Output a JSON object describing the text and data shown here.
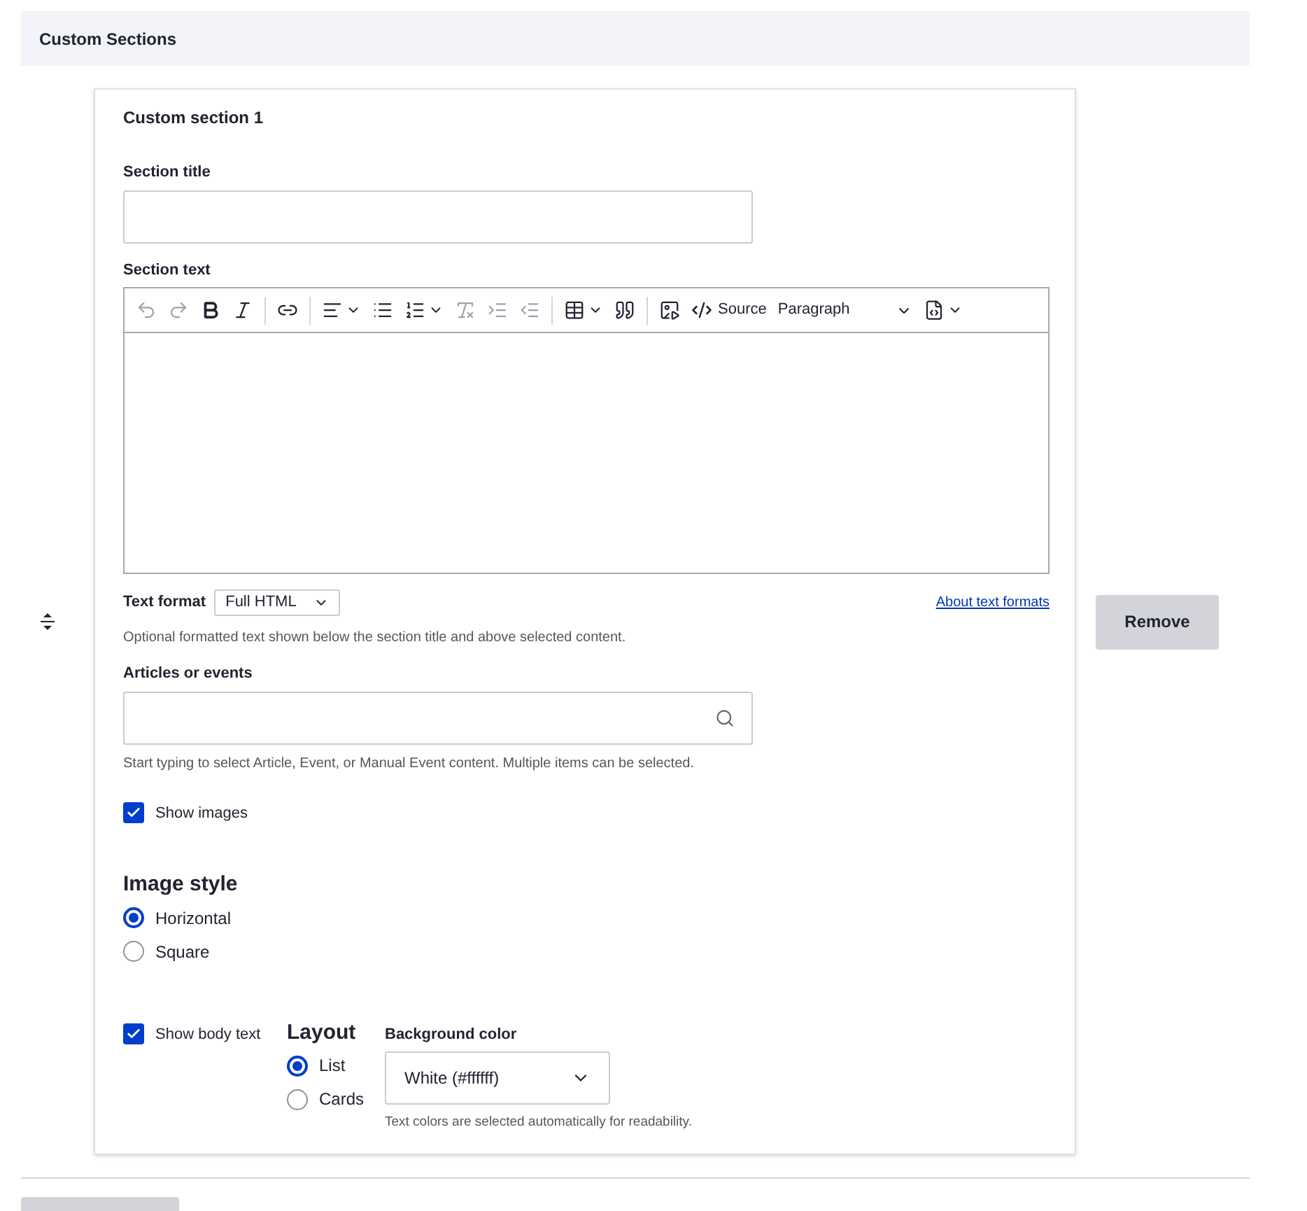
{
  "section_header": {
    "title": "Custom Sections"
  },
  "card": {
    "title": "Custom section 1",
    "section_title": {
      "label": "Section title"
    },
    "section_text": {
      "label": "Section text",
      "toolbar": [
        {
          "kind": "undo",
          "disabled": true
        },
        {
          "kind": "redo",
          "disabled": true
        },
        {
          "kind": "bold",
          "disabled": false
        },
        {
          "kind": "italic",
          "disabled": false
        },
        {
          "kind": "separator"
        },
        {
          "kind": "link",
          "disabled": false
        },
        {
          "kind": "separator"
        },
        {
          "kind": "align",
          "disabled": false
        },
        {
          "kind": "bulleted",
          "disabled": false
        },
        {
          "kind": "numbered",
          "disabled": false
        },
        {
          "kind": "clear",
          "disabled": true
        },
        {
          "kind": "indent",
          "disabled": true
        },
        {
          "kind": "outdent",
          "disabled": true
        },
        {
          "kind": "separator"
        },
        {
          "kind": "table",
          "disabled": false
        },
        {
          "kind": "quote",
          "disabled": false
        },
        {
          "kind": "separator"
        },
        {
          "kind": "media",
          "disabled": false
        },
        {
          "kind": "source",
          "disabled": false,
          "label": "Source"
        },
        {
          "kind": "heading",
          "disabled": false,
          "label": "Paragraph"
        },
        {
          "kind": "more",
          "disabled": false
        }
      ]
    },
    "text_format": {
      "label": "Text format",
      "value": "Full HTML",
      "link": "About text formats",
      "help": "Optional formatted text shown below the section title and above selected content."
    },
    "articles": {
      "label": "Articles or events",
      "help": "Start typing to select Article, Event, or Manual Event content. Multiple items can be selected."
    },
    "show_images": {
      "label": "Show images",
      "checked": true
    },
    "image_style": {
      "title": "Image style",
      "options": [
        {
          "label": "Horizontal",
          "selected": true
        },
        {
          "label": "Square",
          "selected": false
        }
      ]
    },
    "show_body_text": {
      "label": "Show body text",
      "checked": true
    },
    "layout": {
      "title": "Layout",
      "options": [
        {
          "label": "List",
          "selected": true
        },
        {
          "label": "Cards",
          "selected": false
        }
      ]
    },
    "background_color": {
      "label": "Background color",
      "value": "White (#ffffff)",
      "help": "Text colors are selected automatically for readability."
    }
  },
  "remove_button": "Remove"
}
